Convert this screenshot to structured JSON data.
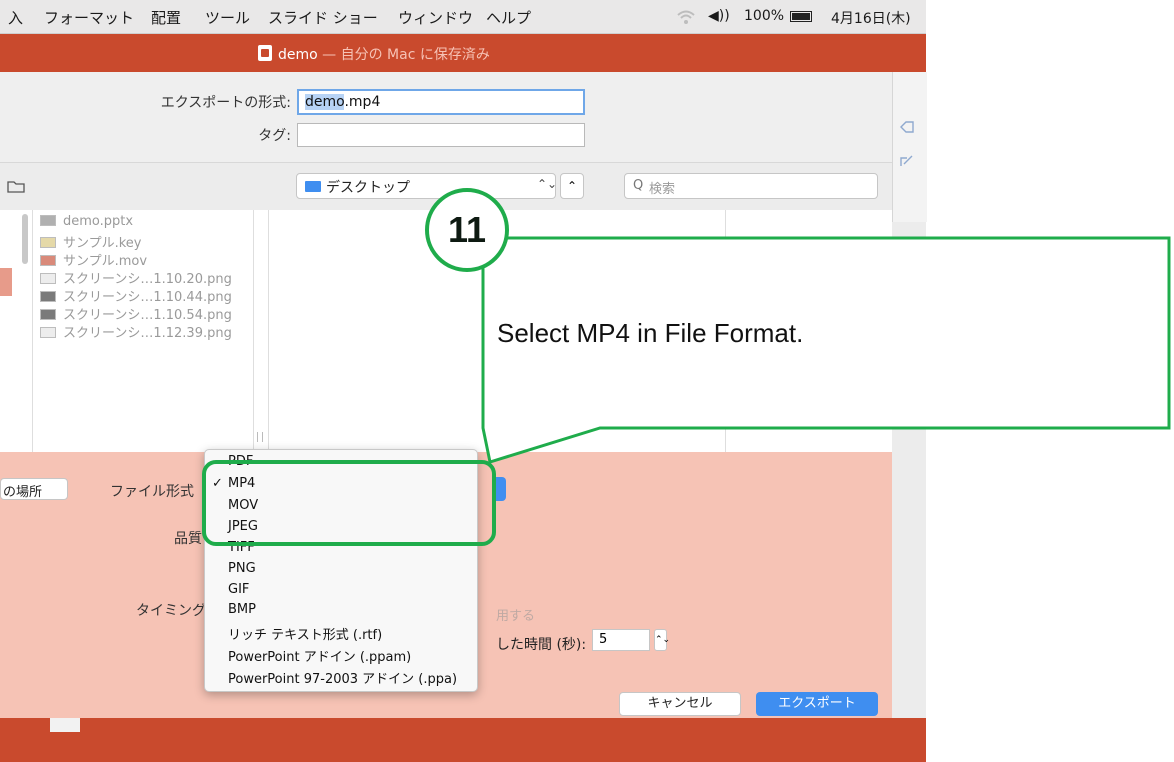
{
  "menubar": {
    "items": [
      "入",
      "フォーマット",
      "配置",
      "ツール",
      "スライド ショー",
      "ウィンドウ",
      "ヘルプ"
    ],
    "battery": "100%",
    "date": "4月16日(木)",
    "wifi_icon": "wifi-icon",
    "volume_icon": "volume-icon",
    "volume_glyph": "◀))",
    "battery_icon": "battery-icon"
  },
  "window": {
    "doc_name": "demo",
    "saved_status": " — 自分の Mac に保存済み"
  },
  "export_form": {
    "format_label": "エクスポートの形式:",
    "filename_selected": "demo",
    "filename_ext": ".mp4",
    "tag_label": "タグ:",
    "tag_value": ""
  },
  "navigator": {
    "location": "デスクトップ",
    "search_placeholder": "検索",
    "stepper_glyph": "⌃⌄",
    "expand_glyph": "⌃",
    "search_glyph": "Q"
  },
  "files": [
    "demo.pptx",
    "サンプル.key",
    "サンプル.mov",
    "スクリーンシ…1.10.20.png",
    "スクリーンシ…1.10.44.png",
    "スクリーンシ…1.10.54.png",
    "スクリーンシ…1.12.39.png"
  ],
  "options": {
    "location_button": "の場所",
    "file_format_label": "ファイル形式",
    "quality_label": "品質",
    "timing_label": "タイミング",
    "timing_use_text": "用する",
    "duration_label": "した時間 (秒):",
    "duration_value": "5",
    "cancel_button": "キャンセル",
    "export_button": "エクスポート",
    "stepper_glyph": "⌃⌄"
  },
  "format_menu": {
    "checkmark": "✓",
    "items": [
      "PDF",
      "MP4",
      "MOV",
      "JPEG",
      "TIFF",
      "PNG",
      "GIF",
      "BMP",
      "リッチ テキスト形式 (.rtf)",
      "PowerPoint アドイン (.ppam)",
      "PowerPoint 97-2003 アドイン (.ppa)"
    ],
    "selected": "MP4"
  },
  "annotation": {
    "step": "11",
    "text": "Select MP4 in File Format.",
    "color": "#1fac4b"
  },
  "colors": {
    "accent_blue": "#3f8ef0",
    "titlebar": "#c94a2d",
    "options_panel": "#f6c3b5"
  }
}
